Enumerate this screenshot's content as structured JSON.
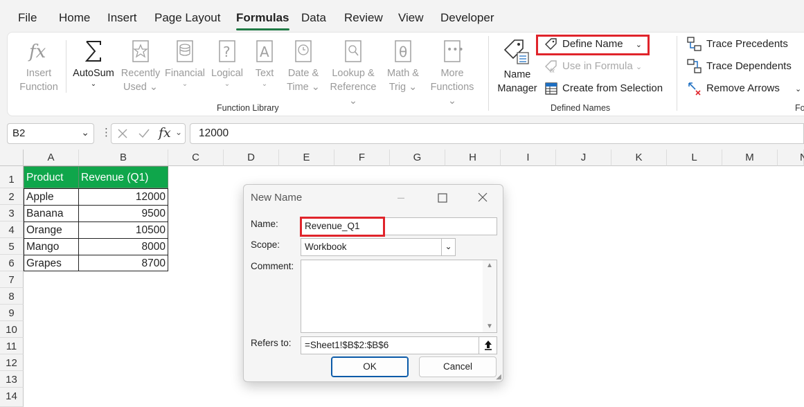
{
  "tabs": [
    "File",
    "Home",
    "Insert",
    "Page Layout",
    "Formulas",
    "Data",
    "Review",
    "View",
    "Developer"
  ],
  "active_tab": "Formulas",
  "function_library": {
    "label": "Function Library",
    "insert_function": [
      "Insert",
      "Function"
    ],
    "autosum": "AutoSum",
    "recently_used": [
      "Recently",
      "Used"
    ],
    "financial": "Financial",
    "logical": "Logical",
    "text": "Text",
    "date_time": [
      "Date &",
      "Time"
    ],
    "lookup": [
      "Lookup &",
      "Reference"
    ],
    "math": [
      "Math &",
      "Trig"
    ],
    "more": [
      "More",
      "Functions"
    ]
  },
  "defined_names": {
    "label": "Defined Names",
    "name_manager": [
      "Name",
      "Manager"
    ],
    "define_name": "Define Name",
    "use_in_formula": "Use in Formula",
    "create_from_selection": "Create from Selection"
  },
  "formula_auditing": {
    "trace_precedents": "Trace Precedents",
    "trace_dependents": "Trace Dependents",
    "remove_arrows": "Remove Arrows",
    "partial_label": "Fo"
  },
  "formula_bar": {
    "name_box": "B2",
    "fx": "fx",
    "value": "12000"
  },
  "columns": [
    "A",
    "B",
    "C",
    "D",
    "E",
    "F",
    "G",
    "H",
    "I",
    "J",
    "K",
    "L",
    "M",
    "N"
  ],
  "rows": [
    "1",
    "2",
    "3",
    "4",
    "5",
    "6",
    "7",
    "8",
    "9",
    "10",
    "11",
    "12",
    "13",
    "14"
  ],
  "table": {
    "headers": [
      "Product",
      "Revenue (Q1)"
    ],
    "rows": [
      [
        "Apple",
        "12000"
      ],
      [
        "Banana",
        "9500"
      ],
      [
        "Orange",
        "10500"
      ],
      [
        "Mango",
        "8000"
      ],
      [
        "Grapes",
        "8700"
      ]
    ]
  },
  "dialog": {
    "title": "New Name",
    "name_label": "Name:",
    "name_value": "Revenue_Q1",
    "scope_label": "Scope:",
    "scope_value": "Workbook",
    "comment_label": "Comment:",
    "comment_value": "",
    "refers_label": "Refers to:",
    "refers_value": "=Sheet1!$B$2:$B$6",
    "ok": "OK",
    "cancel": "Cancel"
  },
  "colors": {
    "header_fill": "#0fa64b",
    "highlight_box": "#e0242b",
    "active_tab_underline": "#1f7a45"
  }
}
